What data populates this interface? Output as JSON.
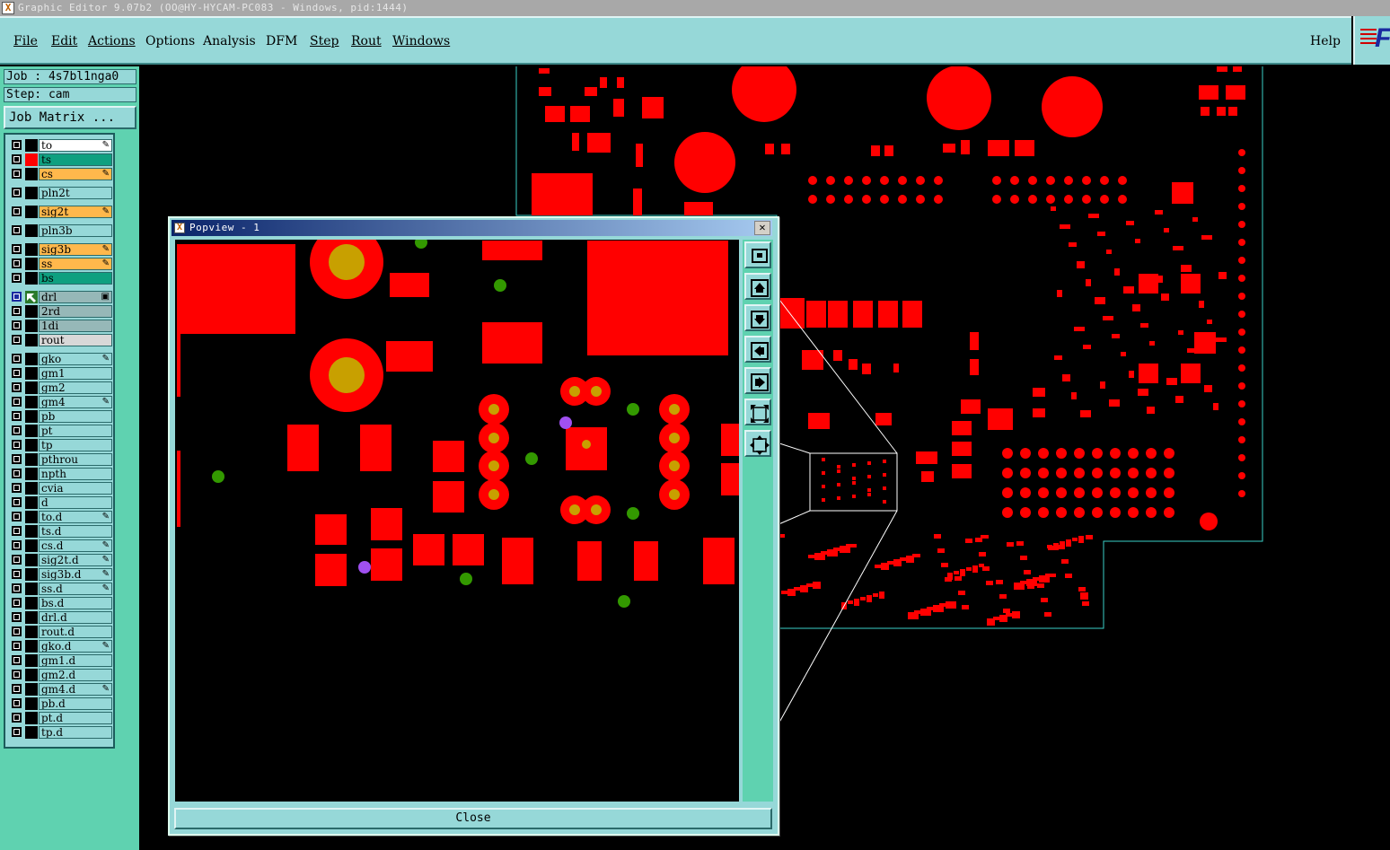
{
  "window": {
    "title": "Graphic Editor 9.07b2 (OO@HY-HYCAM-PC083 - Windows, pid:1444)",
    "icon": "app-x-icon"
  },
  "menu": {
    "file": "File",
    "edit": "Edit",
    "actions": "Actions",
    "options": "Options",
    "analysis": "Analysis",
    "dfm": "DFM",
    "step": "Step",
    "rout": "Rout",
    "windows": "Windows",
    "help": "Help"
  },
  "logo": {
    "letter": "F"
  },
  "job": {
    "job_label": "Job : 4s7bl1nga0",
    "step_label": "Step: cam",
    "matrix_button": "Job Matrix ..."
  },
  "layers": [
    {
      "name": "to",
      "color": "#ffffff",
      "mark": "✎"
    },
    {
      "name": "ts",
      "color": "#0fa080",
      "mark": "",
      "active": "#ff0000"
    },
    {
      "name": "cs",
      "color": "#ffb84c",
      "mark": "✎"
    },
    {
      "name": "pln2t",
      "color": "#96d8d8",
      "mark": ""
    },
    {
      "name": "sig2t",
      "color": "#ffb84c",
      "mark": "✎"
    },
    {
      "name": "pln3b",
      "color": "#96d8d8",
      "mark": ""
    },
    {
      "name": "sig3b",
      "color": "#ffb84c",
      "mark": "✎"
    },
    {
      "name": "ss",
      "color": "#ffb84c",
      "mark": "✎"
    },
    {
      "name": "bs",
      "color": "#0fa080",
      "mark": ""
    },
    {
      "name": "drl",
      "color": "#96b8b8",
      "mark": "▣",
      "selected": true
    },
    {
      "name": "2rd",
      "color": "#96b8b8",
      "mark": ""
    },
    {
      "name": "1di",
      "color": "#96b8b8",
      "mark": ""
    },
    {
      "name": "rout",
      "color": "#d8d8d8",
      "mark": ""
    },
    {
      "name": "gko",
      "color": "#96d8d8",
      "mark": "✎"
    },
    {
      "name": "gm1",
      "color": "#96d8d8",
      "mark": ""
    },
    {
      "name": "gm2",
      "color": "#96d8d8",
      "mark": ""
    },
    {
      "name": "gm4",
      "color": "#96d8d8",
      "mark": "✎"
    },
    {
      "name": "pb",
      "color": "#96d8d8",
      "mark": ""
    },
    {
      "name": "pt",
      "color": "#96d8d8",
      "mark": ""
    },
    {
      "name": "tp",
      "color": "#96d8d8",
      "mark": ""
    },
    {
      "name": "pthrou",
      "color": "#96d8d8",
      "mark": ""
    },
    {
      "name": "npth",
      "color": "#96d8d8",
      "mark": ""
    },
    {
      "name": "cvia",
      "color": "#96d8d8",
      "mark": ""
    },
    {
      "name": "d",
      "color": "#96d8d8",
      "mark": ""
    },
    {
      "name": "to.d",
      "color": "#96d8d8",
      "mark": "✎"
    },
    {
      "name": "ts.d",
      "color": "#96d8d8",
      "mark": ""
    },
    {
      "name": "cs.d",
      "color": "#96d8d8",
      "mark": "✎"
    },
    {
      "name": "sig2t.d",
      "color": "#96d8d8",
      "mark": "✎"
    },
    {
      "name": "sig3b.d",
      "color": "#96d8d8",
      "mark": "✎"
    },
    {
      "name": "ss.d",
      "color": "#96d8d8",
      "mark": "✎"
    },
    {
      "name": "bs.d",
      "color": "#96d8d8",
      "mark": ""
    },
    {
      "name": "drl.d",
      "color": "#96d8d8",
      "mark": ""
    },
    {
      "name": "rout.d",
      "color": "#96d8d8",
      "mark": ""
    },
    {
      "name": "gko.d",
      "color": "#96d8d8",
      "mark": "✎"
    },
    {
      "name": "gm1.d",
      "color": "#96d8d8",
      "mark": ""
    },
    {
      "name": "gm2.d",
      "color": "#96d8d8",
      "mark": ""
    },
    {
      "name": "gm4.d",
      "color": "#96d8d8",
      "mark": "✎"
    },
    {
      "name": "pb.d",
      "color": "#96d8d8",
      "mark": ""
    },
    {
      "name": "pt.d",
      "color": "#96d8d8",
      "mark": ""
    },
    {
      "name": "tp.d",
      "color": "#96d8d8",
      "mark": ""
    }
  ],
  "popview": {
    "title": "Popview - 1",
    "close_x": "✕",
    "close_button": "Close",
    "tools": [
      "zoom-home-icon",
      "pan-up-icon",
      "pan-down-icon",
      "pan-left-icon",
      "pan-right-icon",
      "zoom-fit-icon",
      "zoom-area-icon"
    ]
  },
  "colors": {
    "copper": "#ff0000",
    "drill": "#c8a000",
    "via_green": "#339900",
    "via_purple": "#a050f0",
    "ui_teal": "#96d8d8",
    "panel_green": "#5fd2b0",
    "outline": "#3ad0c8"
  }
}
